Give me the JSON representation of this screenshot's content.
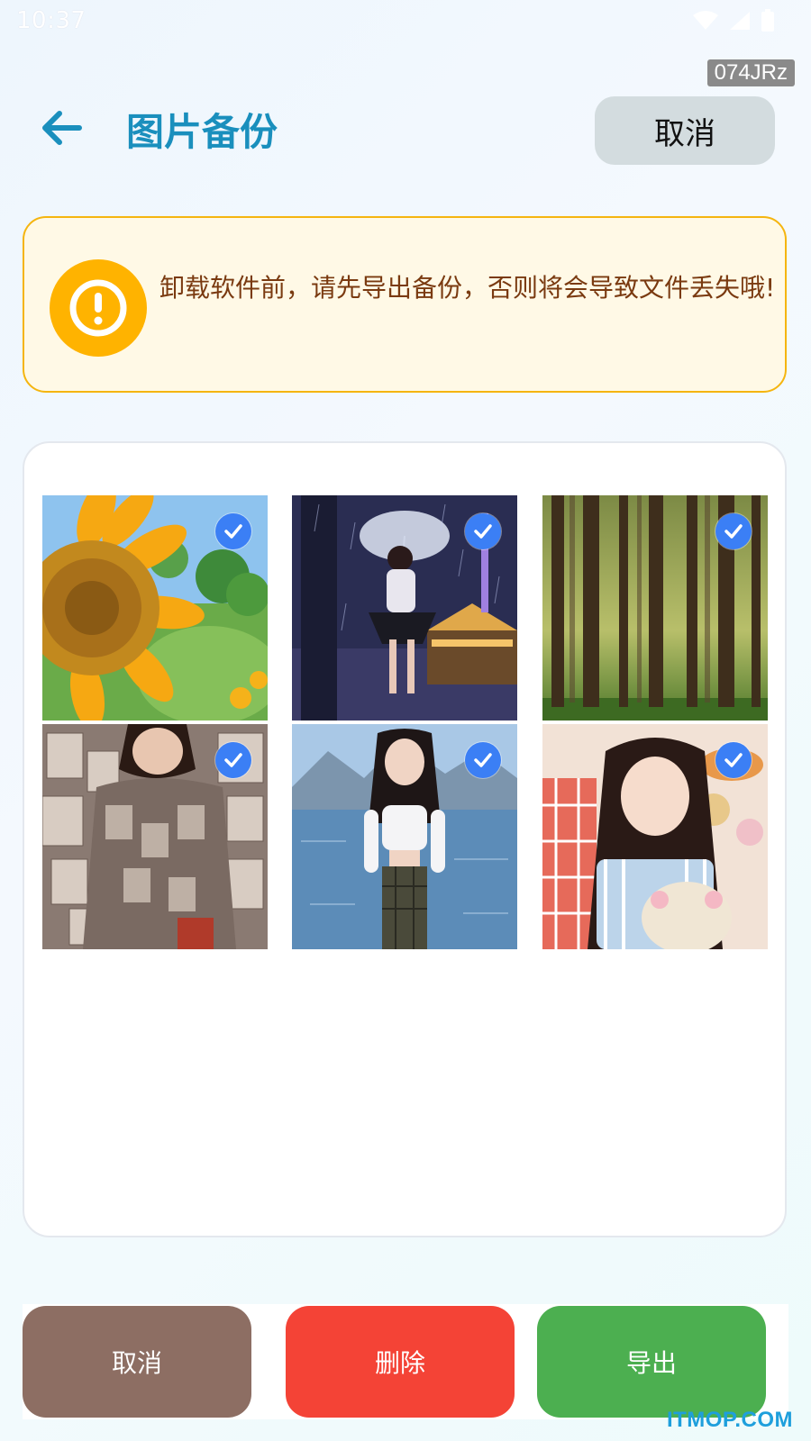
{
  "status_bar": {
    "time": "10:37",
    "icons": [
      "wifi-icon",
      "signal-icon",
      "battery-icon"
    ]
  },
  "build_tag": "074JRz",
  "header": {
    "back_icon": "arrow-left-icon",
    "title": "图片备份",
    "cancel_label": "取消"
  },
  "warning": {
    "icon": "exclamation-circle-icon",
    "text": "卸载软件前，请先导出备份，否则将会导致文件丢失哦!"
  },
  "gallery": {
    "images": [
      {
        "subject": "sunflower",
        "selected": true
      },
      {
        "subject": "girl-with-umbrella-night-rain",
        "selected": true
      },
      {
        "subject": "misty-forest",
        "selected": true
      },
      {
        "subject": "girl-newspaper-wall",
        "selected": true
      },
      {
        "subject": "girl-by-lake-mountains",
        "selected": true
      },
      {
        "subject": "girl-with-plush-toy",
        "selected": true
      }
    ]
  },
  "bottom_bar": {
    "cancel_label": "取消",
    "delete_label": "删除",
    "export_label": "导出"
  },
  "watermark": "ITMOP.COM",
  "colors": {
    "title": "#1a8fbd",
    "warning_border": "#f5b50f",
    "warning_bg": "#fff9e6",
    "warning_icon": "#ffb300",
    "check": "#3b7ff5",
    "cancel_button": "#8d6e63",
    "delete_button": "#f44336",
    "export_button": "#4caf50"
  }
}
